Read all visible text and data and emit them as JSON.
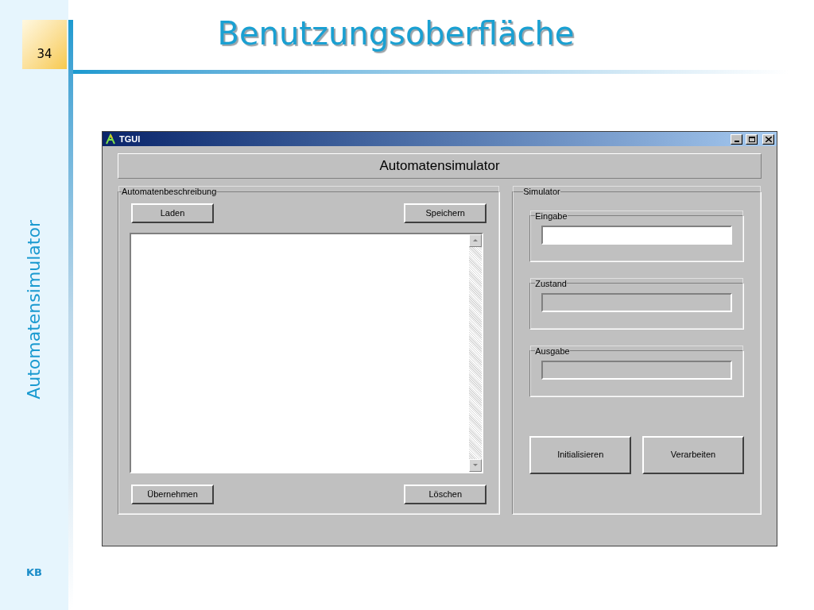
{
  "slide": {
    "number": "34",
    "title": "Benutzungsoberfläche",
    "side_title": "Automatensimulator",
    "footer": "KB"
  },
  "window": {
    "title": "TGUI",
    "heading": "Automatensimulator",
    "description_group": {
      "label": "Automatenbeschreibung",
      "top_buttons": [
        "Laden",
        "Speichern"
      ],
      "bottom_buttons": [
        "Übernehmen",
        "Löschen"
      ]
    },
    "simulator_group": {
      "label": "Simulator",
      "fields": [
        {
          "label": "Eingabe",
          "disabled": false
        },
        {
          "label": "Zustand",
          "disabled": true
        },
        {
          "label": "Ausgabe",
          "disabled": true
        }
      ],
      "buttons": [
        "Initialisieren",
        "Verarbeiten"
      ]
    }
  }
}
